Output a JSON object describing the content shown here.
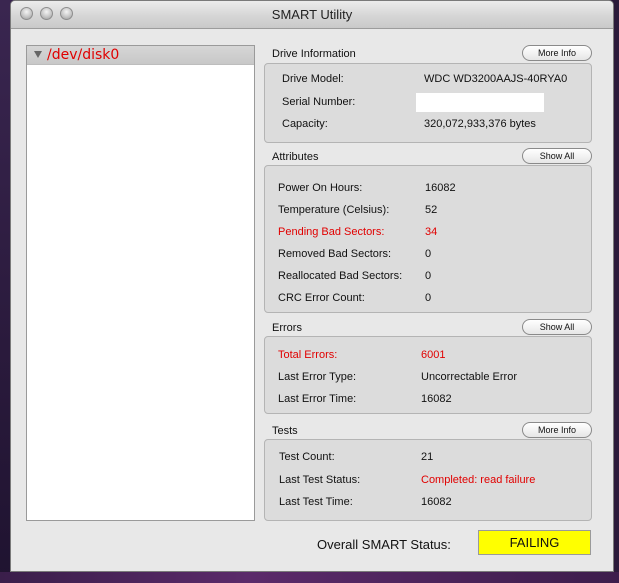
{
  "window": {
    "title": "SMART Utility"
  },
  "sidebar": {
    "items": [
      {
        "label": "/dev/disk0"
      }
    ]
  },
  "drive_info": {
    "title": "Drive Information",
    "button": "More Info",
    "rows": [
      {
        "label": "Drive Model:",
        "value": "WDC WD3200AAJS-40RYA0"
      },
      {
        "label": "Serial Number:",
        "value": ""
      },
      {
        "label": "Capacity:",
        "value": "320,072,933,376 bytes"
      }
    ]
  },
  "attributes": {
    "title": "Attributes",
    "button": "Show All",
    "rows": [
      {
        "label": "Power On Hours:",
        "value": "16082"
      },
      {
        "label": "Temperature (Celsius):",
        "value": "52"
      },
      {
        "label": "Pending Bad Sectors:",
        "value": "34"
      },
      {
        "label": "Removed Bad Sectors:",
        "value": "0"
      },
      {
        "label": "Reallocated Bad Sectors:",
        "value": "0"
      },
      {
        "label": "CRC Error Count:",
        "value": "0"
      }
    ]
  },
  "errors": {
    "title": "Errors",
    "button": "Show All",
    "rows": [
      {
        "label": "Total Errors:",
        "value": "6001"
      },
      {
        "label": "Last Error Type:",
        "value": "Uncorrectable Error"
      },
      {
        "label": "Last Error Time:",
        "value": "16082"
      }
    ]
  },
  "tests": {
    "title": "Tests",
    "button": "More Info",
    "rows": [
      {
        "label": "Test Count:",
        "value": "21"
      },
      {
        "label": "Last Test Status:",
        "value": "Completed: read failure"
      },
      {
        "label": "Last Test Time:",
        "value": "16082"
      }
    ]
  },
  "overall": {
    "label": "Overall SMART Status:",
    "status": "FAILING"
  },
  "colors": {
    "alert": "#e10000",
    "status_bg": "#ffff00"
  },
  "icons": [
    "close-icon",
    "minimize-icon",
    "zoom-icon",
    "disclosure-triangle-icon"
  ]
}
